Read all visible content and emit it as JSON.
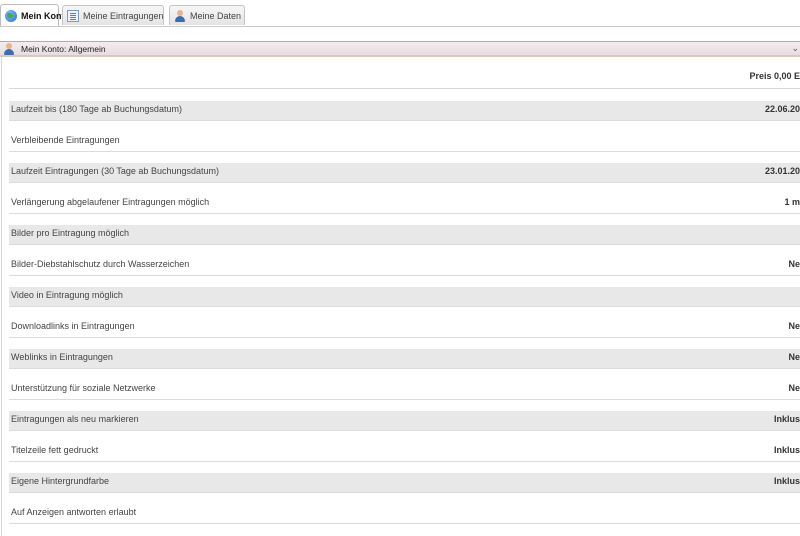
{
  "tabs": [
    {
      "label": "Mein Konto",
      "icon": "globe-icon",
      "active": true
    },
    {
      "label": "Meine Eintragungen",
      "icon": "list-icon",
      "active": false
    },
    {
      "label": "Meine Daten",
      "icon": "person-icon",
      "active": false
    }
  ],
  "panel": {
    "title": "Mein Konto: Allgemein",
    "icon": "user-icon",
    "collapse_icon": "chevron-down-icon",
    "price": "Preis 0,00 E"
  },
  "rows": [
    {
      "label": "Laufzeit bis (180 Tage ab Buchungsdatum)",
      "value": "22.06.20"
    },
    {
      "label": "Verbleibende Eintragungen",
      "value": ""
    },
    {
      "label": "Laufzeit Eintragungen (30 Tage ab Buchungsdatum)",
      "value": "23.01.20"
    },
    {
      "label": "Verlängerung abgelaufener Eintragungen möglich",
      "value": "1 m"
    },
    {
      "label": "Bilder pro Eintragung möglich",
      "value": ""
    },
    {
      "label": "Bilder-Diebstahlschutz durch Wasserzeichen",
      "value": "Ne"
    },
    {
      "label": "Video in Eintragung möglich",
      "value": ""
    },
    {
      "label": "Downloadlinks in Eintragungen",
      "value": "Ne"
    },
    {
      "label": "Weblinks in Eintragungen",
      "value": "Ne"
    },
    {
      "label": "Unterstützung für soziale Netzwerke",
      "value": "Ne"
    },
    {
      "label": "Eintragungen als neu markieren",
      "value": "Inklus"
    },
    {
      "label": "Titelzeile fett gedruckt",
      "value": "Inklus"
    },
    {
      "label": "Eigene Hintergrundfarbe",
      "value": "Inklus"
    },
    {
      "label": "Auf Anzeigen antworten erlaubt",
      "value": ""
    }
  ]
}
